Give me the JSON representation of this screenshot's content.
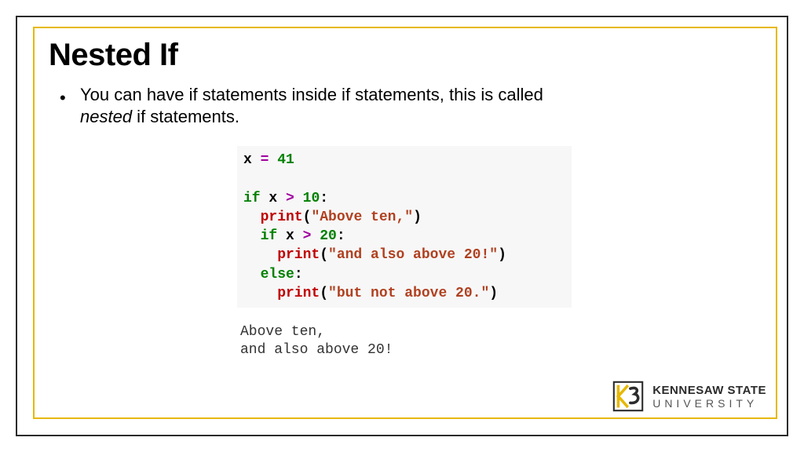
{
  "title": "Nested If",
  "bullet": {
    "text_before": "You can have if statements inside if statements, this is called ",
    "italic": "nested",
    "text_after": " if statements."
  },
  "code": {
    "l1a": "x ",
    "l1b": "=",
    "l1c": " ",
    "l1d": "41",
    "l3a": "if",
    "l3b": " x ",
    "l3c": ">",
    "l3d": " ",
    "l3e": "10",
    "l3f": ":",
    "l4a": "  print",
    "l4b": "(",
    "l4c": "\"Above ten,\"",
    "l4d": ")",
    "l5a": "  ",
    "l5b": "if",
    "l5c": " x ",
    "l5d": ">",
    "l5e": " ",
    "l5f": "20",
    "l5g": ":",
    "l6a": "    print",
    "l6b": "(",
    "l6c": "\"and also above 20!\"",
    "l6d": ")",
    "l7a": "  ",
    "l7b": "else",
    "l7c": ":",
    "l8a": "    print",
    "l8b": "(",
    "l8c": "\"but not above 20.\"",
    "l8d": ")"
  },
  "output": {
    "line1": "Above ten,",
    "line2": "and also above 20!"
  },
  "logo": {
    "top": "KENNESAW STATE",
    "bottom": "UNIVERSITY"
  }
}
